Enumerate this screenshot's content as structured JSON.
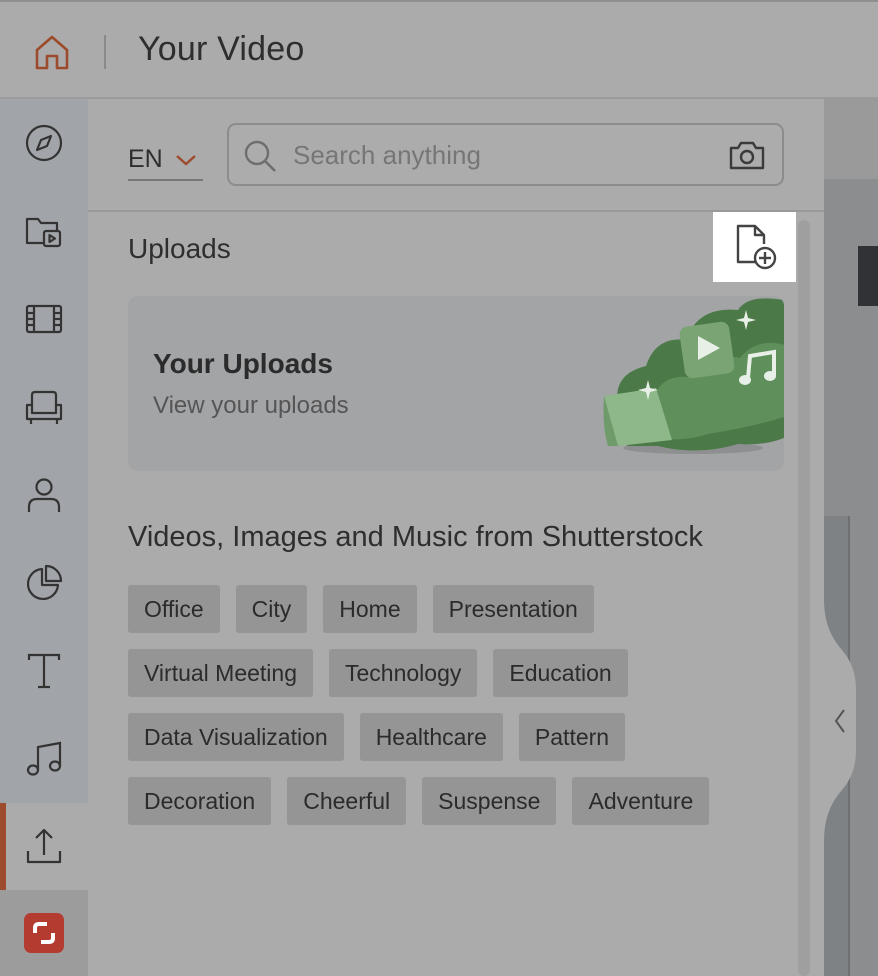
{
  "header": {
    "title": "Your Video",
    "home_icon": "home-icon"
  },
  "rail": {
    "items": [
      {
        "icon": "compass-icon",
        "name": "explore"
      },
      {
        "icon": "folder-video-icon",
        "name": "my-media"
      },
      {
        "icon": "film-icon",
        "name": "videos"
      },
      {
        "icon": "armchair-icon",
        "name": "scenes"
      },
      {
        "icon": "person-icon",
        "name": "characters"
      },
      {
        "icon": "pie-chart-icon",
        "name": "charts"
      },
      {
        "icon": "text-icon",
        "name": "text"
      },
      {
        "icon": "music-note-icon",
        "name": "music"
      },
      {
        "icon": "upload-icon",
        "name": "uploads",
        "active": true
      }
    ],
    "logo_icon": "shutterstock-logo-icon"
  },
  "panel": {
    "language": "EN",
    "search": {
      "placeholder": "Search anything"
    },
    "uploads_title": "Uploads",
    "uploads_card": {
      "title": "Your Uploads",
      "subtitle": "View your uploads"
    },
    "section_title": "Videos, Images and Music from Shutterstock",
    "tags": [
      [
        "Office",
        "City",
        "Home",
        "Presentation"
      ],
      [
        "Virtual Meeting",
        "Technology",
        "Education"
      ],
      [
        "Data Visualization",
        "Healthcare",
        "Pattern"
      ],
      [
        "Decoration",
        "Cheerful",
        "Suspense",
        "Adventure"
      ]
    ]
  },
  "colors": {
    "accent": "#9c4b2d",
    "logo": "#b33b30",
    "art_green": "#4f7d4c"
  }
}
